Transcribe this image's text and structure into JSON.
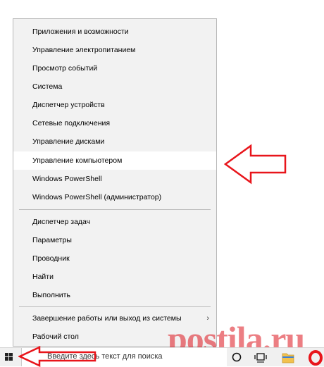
{
  "context_menu": {
    "items": [
      {
        "label": "Приложения и возможности"
      },
      {
        "label": "Управление электропитанием"
      },
      {
        "label": "Просмотр событий"
      },
      {
        "label": "Система"
      },
      {
        "label": "Диспетчер устройств"
      },
      {
        "label": "Сетевые подключения"
      },
      {
        "label": "Управление дисками"
      },
      {
        "label": "Управление компьютером",
        "highlighted": true
      },
      {
        "label": "Windows PowerShell"
      },
      {
        "label": "Windows PowerShell (администратор)"
      },
      {
        "label": "Диспетчер задач"
      },
      {
        "label": "Параметры"
      },
      {
        "label": "Проводник"
      },
      {
        "label": "Найти"
      },
      {
        "label": "Выполнить"
      },
      {
        "label": "Завершение работы или выход из системы",
        "has_submenu": true
      },
      {
        "label": "Рабочий стол"
      }
    ]
  },
  "taskbar": {
    "search_placeholder": "Введите здесь текст для поиска",
    "icons": [
      "windows-start-icon",
      "cortana-circle-icon",
      "task-view-icon",
      "file-explorer-icon",
      "opera-icon"
    ]
  },
  "watermark": {
    "text": "postila.ru"
  },
  "annotations": {
    "arrow_color": "#e8151b",
    "arrows": [
      "arrow-to-manage-computer",
      "arrow-to-start-button"
    ]
  },
  "colors": {
    "menu_bg": "#f2f2f2",
    "highlight_bg": "#ffffff",
    "taskbar_bg": "#f0f0f0",
    "folder": "#f2c14e",
    "opera": "#e8151b"
  }
}
